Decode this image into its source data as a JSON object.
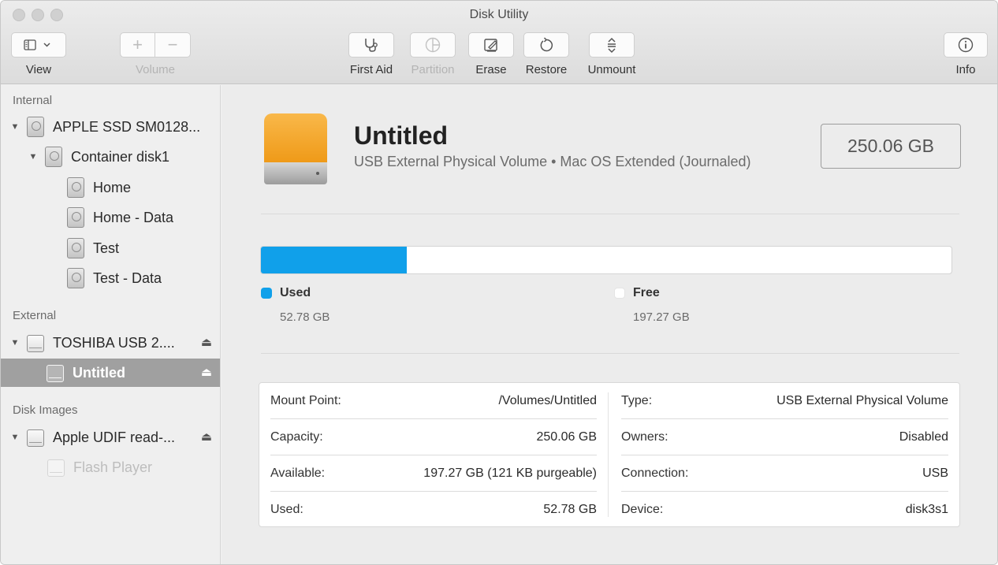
{
  "window": {
    "title": "Disk Utility"
  },
  "toolbar": {
    "view_label": "View",
    "volume_label": "Volume",
    "first_aid_label": "First Aid",
    "partition_label": "Partition",
    "erase_label": "Erase",
    "restore_label": "Restore",
    "unmount_label": "Unmount",
    "info_label": "Info"
  },
  "sidebar": {
    "internal_heading": "Internal",
    "external_heading": "External",
    "disk_images_heading": "Disk Images",
    "internal_items": [
      {
        "label": "APPLE SSD SM0128...",
        "icon": "internal-disk-icon"
      },
      {
        "label": "Container disk1",
        "icon": "internal-disk-icon"
      },
      {
        "label": "Home",
        "icon": "volume-icon"
      },
      {
        "label": "Home - Data",
        "icon": "volume-icon"
      },
      {
        "label": "Test",
        "icon": "volume-icon"
      },
      {
        "label": "Test - Data",
        "icon": "volume-icon"
      }
    ],
    "external_items": [
      {
        "label": "TOSHIBA USB 2....",
        "icon": "external-disk-icon"
      },
      {
        "label": "Untitled",
        "icon": "external-disk-icon",
        "selected": true
      }
    ],
    "disk_image_items": [
      {
        "label": "Apple UDIF read-...",
        "icon": "external-disk-icon"
      },
      {
        "label": "Flash Player",
        "icon": "external-disk-icon",
        "dimmed": true
      }
    ],
    "eject_glyph": "⏏"
  },
  "volume": {
    "name": "Untitled",
    "description": "USB External Physical Volume • Mac OS Extended (Journaled)",
    "size": "250.06 GB"
  },
  "usage": {
    "used_fraction": 0.211,
    "used_label": "Used",
    "used_value": "52.78 GB",
    "free_label": "Free",
    "free_value": "197.27 GB",
    "used_color": "#10a0ea",
    "free_color": "#ffffff"
  },
  "info": {
    "left": [
      {
        "key": "Mount Point:",
        "value": "/Volumes/Untitled"
      },
      {
        "key": "Capacity:",
        "value": "250.06 GB"
      },
      {
        "key": "Available:",
        "value": "197.27 GB (121 KB purgeable)"
      },
      {
        "key": "Used:",
        "value": "52.78 GB"
      }
    ],
    "right": [
      {
        "key": "Type:",
        "value": "USB External Physical Volume"
      },
      {
        "key": "Owners:",
        "value": "Disabled"
      },
      {
        "key": "Connection:",
        "value": "USB"
      },
      {
        "key": "Device:",
        "value": "disk3s1"
      }
    ]
  }
}
